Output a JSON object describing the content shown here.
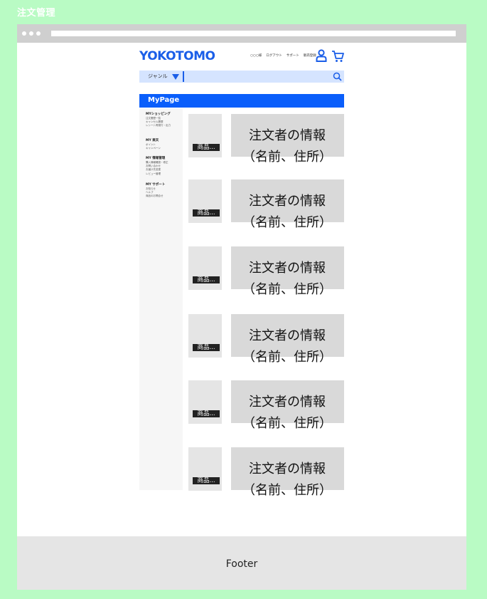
{
  "page_label": "注文管理",
  "header": {
    "logo": "YOKOTOMO",
    "links": [
      "○○○様",
      "ログアウト",
      "サポート",
      "販売登録"
    ]
  },
  "search": {
    "genre_label": "ジャンル",
    "placeholder": ""
  },
  "mypage": {
    "title": "MyPage"
  },
  "sidebar": {
    "sections": [
      {
        "heading": "MYショッピング",
        "items": [
          "注文履歴一覧",
          "キャンセル履歴",
          "レシート再発行・出力"
        ]
      },
      {
        "heading": "MY 楽天",
        "items": [
          "ポイント",
          "キャンペーン"
        ]
      },
      {
        "heading": "MY 情報管理",
        "items": [
          "購入情報確認・修正",
          "お問い合わせ",
          "お届け先変更",
          "レビュー管理"
        ]
      },
      {
        "heading": "MY サポート",
        "items": [
          "お知らせ",
          "ヘルプ",
          "商品のお問合せ"
        ]
      }
    ]
  },
  "orders": [
    {
      "thumb_label": "商品...",
      "info": "注文者の情報（名前、住所）"
    },
    {
      "thumb_label": "商品...",
      "info": "注文者の情報（名前、住所）"
    },
    {
      "thumb_label": "商品...",
      "info": "注文者の情報（名前、住所）"
    },
    {
      "thumb_label": "商品...",
      "info": "注文者の情報（名前、住所）"
    },
    {
      "thumb_label": "商品...",
      "info": "注文者の情報（名前、住所）"
    },
    {
      "thumb_label": "商品...",
      "info": "注文者の情報（名前、住所）"
    }
  ],
  "footer": {
    "label": "Footer"
  },
  "colors": {
    "background": "#b9fbc4",
    "brand": "#1a5ee8",
    "mypage_bar": "#0a5efb",
    "search_bg": "#d5e4ff"
  },
  "icons": [
    "user-icon",
    "cart-icon",
    "search-icon",
    "dropdown-arrow-icon"
  ]
}
